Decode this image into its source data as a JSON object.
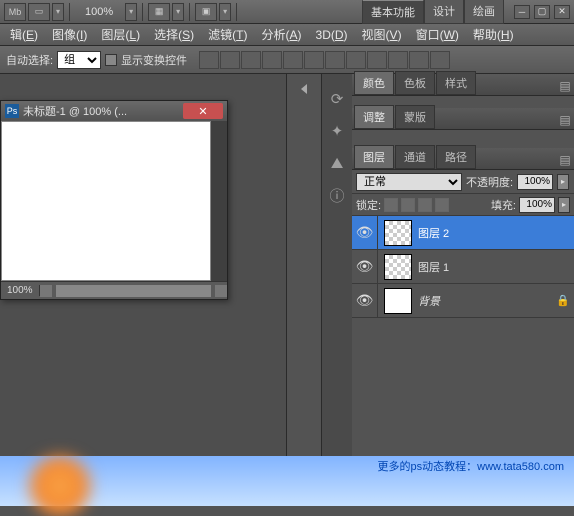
{
  "toolbar": {
    "mb_label": "Mb",
    "zoom": "100%",
    "workspace_tabs": [
      "基本功能",
      "设计",
      "绘画"
    ],
    "active_workspace": 0
  },
  "menu": {
    "items": [
      {
        "label": "辑",
        "accel": "E"
      },
      {
        "label": "图像",
        "accel": "I"
      },
      {
        "label": "图层",
        "accel": "L"
      },
      {
        "label": "选择",
        "accel": "S"
      },
      {
        "label": "滤镜",
        "accel": "T"
      },
      {
        "label": "分析",
        "accel": "A"
      },
      {
        "label": "3D",
        "accel": "D"
      },
      {
        "label": "视图",
        "accel": "V"
      },
      {
        "label": "窗口",
        "accel": "W"
      },
      {
        "label": "帮助",
        "accel": "H"
      }
    ]
  },
  "options": {
    "autoselect": "自动选择:",
    "group_value": "组",
    "show_transform": "显示变换控件"
  },
  "document": {
    "title": "未标题-1 @ 100% (...",
    "zoom": "100%"
  },
  "panels": {
    "group1": [
      "颜色",
      "色板",
      "样式"
    ],
    "group2": [
      "调整",
      "蒙版"
    ],
    "group3": [
      "图层",
      "通道",
      "路径"
    ]
  },
  "layers_panel": {
    "blend_mode": "正常",
    "opacity_label": "不透明度:",
    "opacity_value": "100%",
    "lock_label": "锁定:",
    "fill_label": "填充:",
    "fill_value": "100%",
    "layers": [
      {
        "name": "图层 2",
        "selected": true,
        "checker": true,
        "locked": false
      },
      {
        "name": "图层 1",
        "selected": false,
        "checker": true,
        "locked": false
      },
      {
        "name": "背景",
        "selected": false,
        "checker": false,
        "locked": true,
        "italic": true
      }
    ]
  },
  "footer": {
    "credit_label": "更多的ps动态教程：",
    "credit_url": "www.tata580.com"
  }
}
